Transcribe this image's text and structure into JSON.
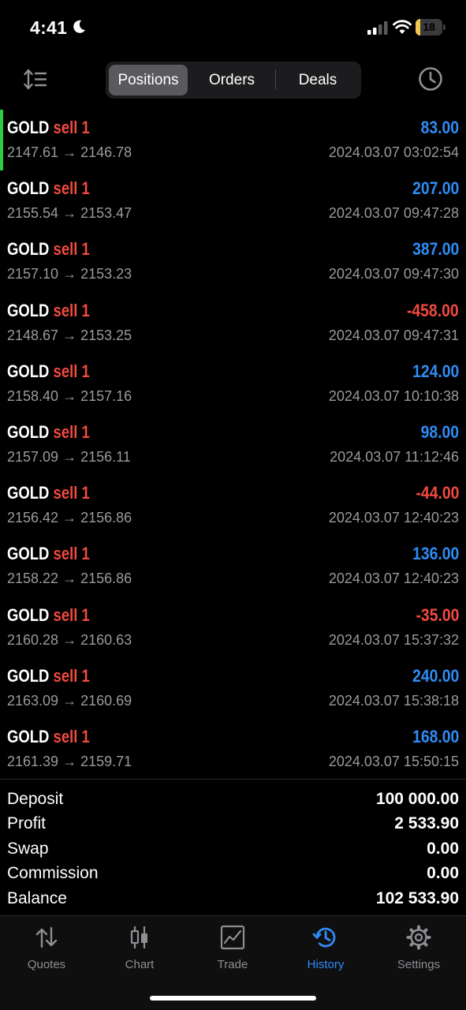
{
  "status_bar": {
    "time": "4:41",
    "battery_level": "18",
    "battery_fraction": 0.18,
    "battery_color": "#f2c94c"
  },
  "header": {
    "tabs": [
      {
        "label": "Positions",
        "active": true
      },
      {
        "label": "Orders",
        "active": false
      },
      {
        "label": "Deals",
        "active": false
      }
    ]
  },
  "positions": [
    {
      "symbol": "GOLD",
      "side": "sell 1",
      "prices": "2147.61 → 2146.78",
      "profit": "83.00",
      "datetime": "2024.03.07 03:02:54",
      "selected": true
    },
    {
      "symbol": "GOLD",
      "side": "sell 1",
      "prices": "2155.54 → 2153.47",
      "profit": "207.00",
      "datetime": "2024.03.07 09:47:28"
    },
    {
      "symbol": "GOLD",
      "side": "sell 1",
      "prices": "2157.10 → 2153.23",
      "profit": "387.00",
      "datetime": "2024.03.07 09:47:30"
    },
    {
      "symbol": "GOLD",
      "side": "sell 1",
      "prices": "2148.67 → 2153.25",
      "profit": "-458.00",
      "datetime": "2024.03.07 09:47:31"
    },
    {
      "symbol": "GOLD",
      "side": "sell 1",
      "prices": "2158.40 → 2157.16",
      "profit": "124.00",
      "datetime": "2024.03.07 10:10:38"
    },
    {
      "symbol": "GOLD",
      "side": "sell 1",
      "prices": "2157.09 → 2156.11",
      "profit": "98.00",
      "datetime": "2024.03.07 11:12:46"
    },
    {
      "symbol": "GOLD",
      "side": "sell 1",
      "prices": "2156.42 → 2156.86",
      "profit": "-44.00",
      "datetime": "2024.03.07 12:40:23"
    },
    {
      "symbol": "GOLD",
      "side": "sell 1",
      "prices": "2158.22 → 2156.86",
      "profit": "136.00",
      "datetime": "2024.03.07 12:40:23"
    },
    {
      "symbol": "GOLD",
      "side": "sell 1",
      "prices": "2160.28 → 2160.63",
      "profit": "-35.00",
      "datetime": "2024.03.07 15:37:32"
    },
    {
      "symbol": "GOLD",
      "side": "sell 1",
      "prices": "2163.09 → 2160.69",
      "profit": "240.00",
      "datetime": "2024.03.07 15:38:18"
    },
    {
      "symbol": "GOLD",
      "side": "sell 1",
      "prices": "2161.39 → 2159.71",
      "profit": "168.00",
      "datetime": "2024.03.07 15:50:15"
    }
  ],
  "summary": [
    {
      "label": "Deposit",
      "value": "100 000.00"
    },
    {
      "label": "Profit",
      "value": "2 533.90"
    },
    {
      "label": "Swap",
      "value": "0.00"
    },
    {
      "label": "Commission",
      "value": "0.00"
    },
    {
      "label": "Balance",
      "value": "102 533.90"
    }
  ],
  "tabbar": {
    "items": [
      {
        "label": "Quotes",
        "icon": "quotes-icon",
        "active": false
      },
      {
        "label": "Chart",
        "icon": "chart-icon",
        "active": false
      },
      {
        "label": "Trade",
        "icon": "trade-icon",
        "active": false
      },
      {
        "label": "History",
        "icon": "history-icon",
        "active": true
      },
      {
        "label": "Settings",
        "icon": "settings-icon",
        "active": false
      }
    ]
  },
  "colors": {
    "profit_positive": "#2f8cf5",
    "profit_negative": "#f24a40",
    "sell": "#f24a40",
    "accent_active": "#2f8cf5",
    "selection_marker": "#2ecc40"
  }
}
